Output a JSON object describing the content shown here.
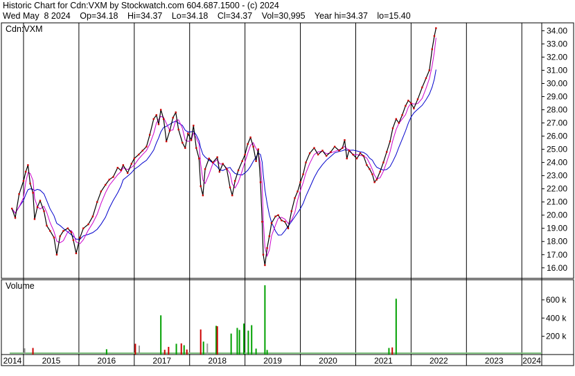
{
  "header": {
    "title": "Historic Chart for Cdn:VXM by Stockwatch.com 604.687.1500 - (c) 2024",
    "date": "Wed May  8 2024",
    "open": "Op=34.18",
    "high": "Hi=34.37",
    "low": "Lo=34.18",
    "close": "Cl=34.37",
    "volume": "Vol=30,995",
    "year_high": "Year hi=34.37",
    "year_low": "lo=15.40"
  },
  "colors": {
    "price": "#000000",
    "ma_short": "#cc00cc",
    "ma_long": "#0000cc",
    "vol_up": "#00a000",
    "vol_down": "#cc0000",
    "vol_flat": "#999999",
    "grid": "#000000"
  },
  "chart_data": [
    {
      "type": "line",
      "symbol_label": "Cdn:VXM",
      "ylim": [
        15.2,
        34.6
      ],
      "y_ticks": [
        "16.00",
        "17.00",
        "18.00",
        "19.00",
        "20.00",
        "21.00",
        "22.00",
        "23.00",
        "24.00",
        "25.00",
        "26.00",
        "27.00",
        "28.00",
        "29.00",
        "30.00",
        "31.00",
        "32.00",
        "33.00",
        "34.00"
      ],
      "x_years": [
        "2014",
        "2015",
        "2016",
        "2017",
        "2018",
        "2019",
        "2020",
        "2021",
        "2022",
        "2023",
        "2024"
      ],
      "x_range": [
        2014.6,
        2024.36
      ],
      "series": [
        {
          "name": "",
          "points": [
            [
              2014.79,
              20.5
            ],
            [
              2014.85,
              19.8
            ],
            [
              2014.92,
              21.6
            ],
            [
              2015.0,
              22.6
            ],
            [
              2015.04,
              23.3
            ],
            [
              2015.08,
              23.8
            ],
            [
              2015.12,
              22.4
            ],
            [
              2015.17,
              21.7
            ],
            [
              2015.2,
              19.7
            ],
            [
              2015.25,
              20.6
            ],
            [
              2015.3,
              21.1
            ],
            [
              2015.37,
              20.3
            ],
            [
              2015.42,
              19.2
            ],
            [
              2015.48,
              18.8
            ],
            [
              2015.55,
              18.3
            ],
            [
              2015.6,
              17.0
            ],
            [
              2015.66,
              18.4
            ],
            [
              2015.72,
              18.8
            ],
            [
              2015.8,
              19.0
            ],
            [
              2015.86,
              18.7
            ],
            [
              2015.9,
              18.1
            ],
            [
              2015.95,
              17.1
            ],
            [
              2016.02,
              18.3
            ],
            [
              2016.08,
              19.0
            ],
            [
              2016.17,
              19.3
            ],
            [
              2016.25,
              19.9
            ],
            [
              2016.33,
              21.0
            ],
            [
              2016.4,
              21.8
            ],
            [
              2016.48,
              22.3
            ],
            [
              2016.55,
              22.7
            ],
            [
              2016.62,
              22.9
            ],
            [
              2016.7,
              23.6
            ],
            [
              2016.76,
              23.4
            ],
            [
              2016.8,
              23.8
            ],
            [
              2016.88,
              23.2
            ],
            [
              2016.95,
              23.9
            ],
            [
              2017.0,
              24.3
            ],
            [
              2017.08,
              24.6
            ],
            [
              2017.15,
              24.9
            ],
            [
              2017.22,
              25.2
            ],
            [
              2017.28,
              26.1
            ],
            [
              2017.35,
              27.3
            ],
            [
              2017.4,
              27.6
            ],
            [
              2017.44,
              26.9
            ],
            [
              2017.48,
              28.0
            ],
            [
              2017.53,
              27.3
            ],
            [
              2017.58,
              25.6
            ],
            [
              2017.64,
              26.4
            ],
            [
              2017.7,
              27.4
            ],
            [
              2017.75,
              27.8
            ],
            [
              2017.8,
              26.5
            ],
            [
              2017.87,
              25.5
            ],
            [
              2017.92,
              25.1
            ],
            [
              2017.97,
              26.2
            ],
            [
              2018.03,
              25.7
            ],
            [
              2018.07,
              26.8
            ],
            [
              2018.12,
              25.1
            ],
            [
              2018.17,
              24.3
            ],
            [
              2018.2,
              22.2
            ],
            [
              2018.24,
              21.5
            ],
            [
              2018.28,
              23.5
            ],
            [
              2018.35,
              24.3
            ],
            [
              2018.42,
              24.0
            ],
            [
              2018.5,
              24.4
            ],
            [
              2018.54,
              23.3
            ],
            [
              2018.6,
              23.9
            ],
            [
              2018.67,
              23.5
            ],
            [
              2018.73,
              22.1
            ],
            [
              2018.77,
              21.5
            ],
            [
              2018.82,
              22.6
            ],
            [
              2018.88,
              23.4
            ],
            [
              2018.95,
              24.1
            ],
            [
              2019.0,
              24.6
            ],
            [
              2019.05,
              25.4
            ],
            [
              2019.1,
              25.9
            ],
            [
              2019.15,
              25.2
            ],
            [
              2019.2,
              24.1
            ],
            [
              2019.24,
              25.0
            ],
            [
              2019.28,
              22.5
            ],
            [
              2019.31,
              19.5
            ],
            [
              2019.33,
              17.0
            ],
            [
              2019.36,
              16.2
            ],
            [
              2019.4,
              17.5
            ],
            [
              2019.44,
              18.4
            ],
            [
              2019.48,
              19.4
            ],
            [
              2019.55,
              19.9
            ],
            [
              2019.6,
              20.0
            ],
            [
              2019.66,
              19.6
            ],
            [
              2019.72,
              19.5
            ],
            [
              2019.78,
              19.0
            ],
            [
              2019.84,
              20.3
            ],
            [
              2019.9,
              21.3
            ],
            [
              2019.95,
              21.8
            ],
            [
              2020.0,
              22.5
            ],
            [
              2020.05,
              23.1
            ],
            [
              2020.1,
              24.0
            ],
            [
              2020.17,
              24.7
            ],
            [
              2020.25,
              25.1
            ],
            [
              2020.32,
              24.6
            ],
            [
              2020.4,
              24.9
            ],
            [
              2020.47,
              24.5
            ],
            [
              2020.55,
              24.8
            ],
            [
              2020.62,
              25.2
            ],
            [
              2020.7,
              24.9
            ],
            [
              2020.76,
              25.1
            ],
            [
              2020.8,
              25.7
            ],
            [
              2020.84,
              24.3
            ],
            [
              2020.88,
              24.9
            ],
            [
              2020.95,
              24.6
            ],
            [
              2021.02,
              24.3
            ],
            [
              2021.08,
              24.7
            ],
            [
              2021.14,
              24.5
            ],
            [
              2021.2,
              23.8
            ],
            [
              2021.25,
              23.5
            ],
            [
              2021.3,
              23.1
            ],
            [
              2021.34,
              22.5
            ],
            [
              2021.38,
              22.7
            ],
            [
              2021.44,
              23.3
            ],
            [
              2021.5,
              24.0
            ],
            [
              2021.56,
              24.8
            ],
            [
              2021.62,
              25.6
            ],
            [
              2021.67,
              26.6
            ],
            [
              2021.73,
              27.3
            ],
            [
              2021.78,
              27.0
            ],
            [
              2021.84,
              27.6
            ],
            [
              2021.9,
              28.3
            ],
            [
              2021.95,
              28.7
            ],
            [
              2022.0,
              28.5
            ],
            [
              2022.05,
              28.1
            ],
            [
              2022.12,
              28.8
            ],
            [
              2022.2,
              29.7
            ],
            [
              2022.27,
              30.4
            ],
            [
              2022.33,
              31.0
            ],
            [
              2022.38,
              32.6
            ],
            [
              2022.42,
              33.6
            ],
            [
              2022.45,
              34.2
            ]
          ]
        }
      ]
    },
    {
      "type": "bar",
      "title": "Volume",
      "ylim": [
        0,
        820000
      ],
      "y_ticks": [
        "200 k",
        "400 k",
        "600 k"
      ],
      "bars": [
        {
          "x": 2015.02,
          "v": 68000,
          "c": "vol_flat"
        },
        {
          "x": 2015.17,
          "v": 72000,
          "c": "vol_down"
        },
        {
          "x": 2016.5,
          "v": 58000,
          "c": "vol_up"
        },
        {
          "x": 2017.02,
          "v": 118000,
          "c": "vol_down"
        },
        {
          "x": 2017.09,
          "v": 98000,
          "c": "vol_flat"
        },
        {
          "x": 2017.48,
          "v": 430000,
          "c": "vol_up"
        },
        {
          "x": 2017.55,
          "v": 52000,
          "c": "vol_down"
        },
        {
          "x": 2017.62,
          "v": 84000,
          "c": "vol_down"
        },
        {
          "x": 2017.76,
          "v": 118000,
          "c": "vol_up"
        },
        {
          "x": 2017.85,
          "v": 122000,
          "c": "vol_down"
        },
        {
          "x": 2017.9,
          "v": 102000,
          "c": "vol_up"
        },
        {
          "x": 2017.95,
          "v": 55000,
          "c": "vol_down"
        },
        {
          "x": 2018.2,
          "v": 275000,
          "c": "vol_down"
        },
        {
          "x": 2018.25,
          "v": 142000,
          "c": "vol_up"
        },
        {
          "x": 2018.32,
          "v": 120000,
          "c": "vol_flat"
        },
        {
          "x": 2018.48,
          "v": 315000,
          "c": "vol_up"
        },
        {
          "x": 2018.5,
          "v": 310000,
          "c": "vol_down"
        },
        {
          "x": 2018.75,
          "v": 230000,
          "c": "vol_up"
        },
        {
          "x": 2018.86,
          "v": 292000,
          "c": "vol_up"
        },
        {
          "x": 2018.9,
          "v": 270000,
          "c": "vol_up"
        },
        {
          "x": 2018.98,
          "v": 340000,
          "c": "vol_up"
        },
        {
          "x": 2019.06,
          "v": 262000,
          "c": "vol_up"
        },
        {
          "x": 2019.12,
          "v": 322000,
          "c": "vol_up"
        },
        {
          "x": 2019.2,
          "v": 65000,
          "c": "vol_up"
        },
        {
          "x": 2019.36,
          "v": 760000,
          "c": "vol_up"
        },
        {
          "x": 2019.4,
          "v": 50000,
          "c": "vol_up"
        },
        {
          "x": 2021.73,
          "v": 612000,
          "c": "vol_up"
        },
        {
          "x": 2021.6,
          "v": 72000,
          "c": "vol_up"
        },
        {
          "x": 2021.66,
          "v": 78000,
          "c": "vol_down"
        }
      ]
    }
  ]
}
